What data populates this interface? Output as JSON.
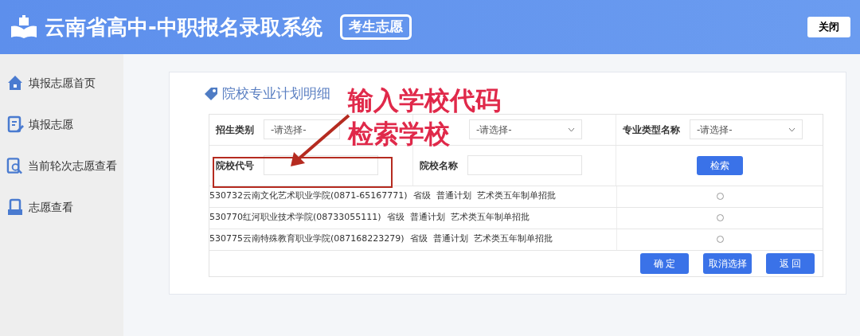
{
  "header": {
    "title": "云南省高中-中职报名录取系统",
    "badge": "考生志愿",
    "close_button": "关闭"
  },
  "sidebar": {
    "items": [
      {
        "label": "填报志愿首页",
        "kind": "home"
      },
      {
        "label": "填报志愿",
        "kind": "edit"
      },
      {
        "label": "当前轮次志愿查看",
        "kind": "search"
      },
      {
        "label": "志愿查看",
        "kind": "doc"
      }
    ]
  },
  "panel": {
    "title": "院校专业计划明细",
    "filters": [
      {
        "label": "招生类别",
        "kind": "select",
        "value": "-请选择-"
      },
      {
        "kind": "select",
        "value": "-请选择-"
      },
      {
        "label": "专业类型名称",
        "kind": "select",
        "value": "-请选择-"
      },
      {
        "label": "院校代号",
        "kind": "input"
      },
      {
        "label": "院校名称",
        "kind": "input"
      }
    ],
    "search_button": "检索",
    "results": [
      {
        "text": "530732云南文化艺术职业学院(0871-65167771)  省级  普通计划  艺术类五年制单招批",
        "selected": false
      },
      {
        "text": "530770红河职业技术学院(08733055111)  省级  普通计划  艺术类五年制单招批",
        "selected": false
      },
      {
        "text": "530775云南特殊教育职业学院(087168223279)  省级  普通计划  艺术类五年制单招批",
        "selected": false
      }
    ],
    "buttons": [
      "确 定",
      "取消选择",
      "返 回"
    ]
  },
  "annotation": {
    "lines": [
      "输入学校代码",
      "检索学校"
    ]
  }
}
